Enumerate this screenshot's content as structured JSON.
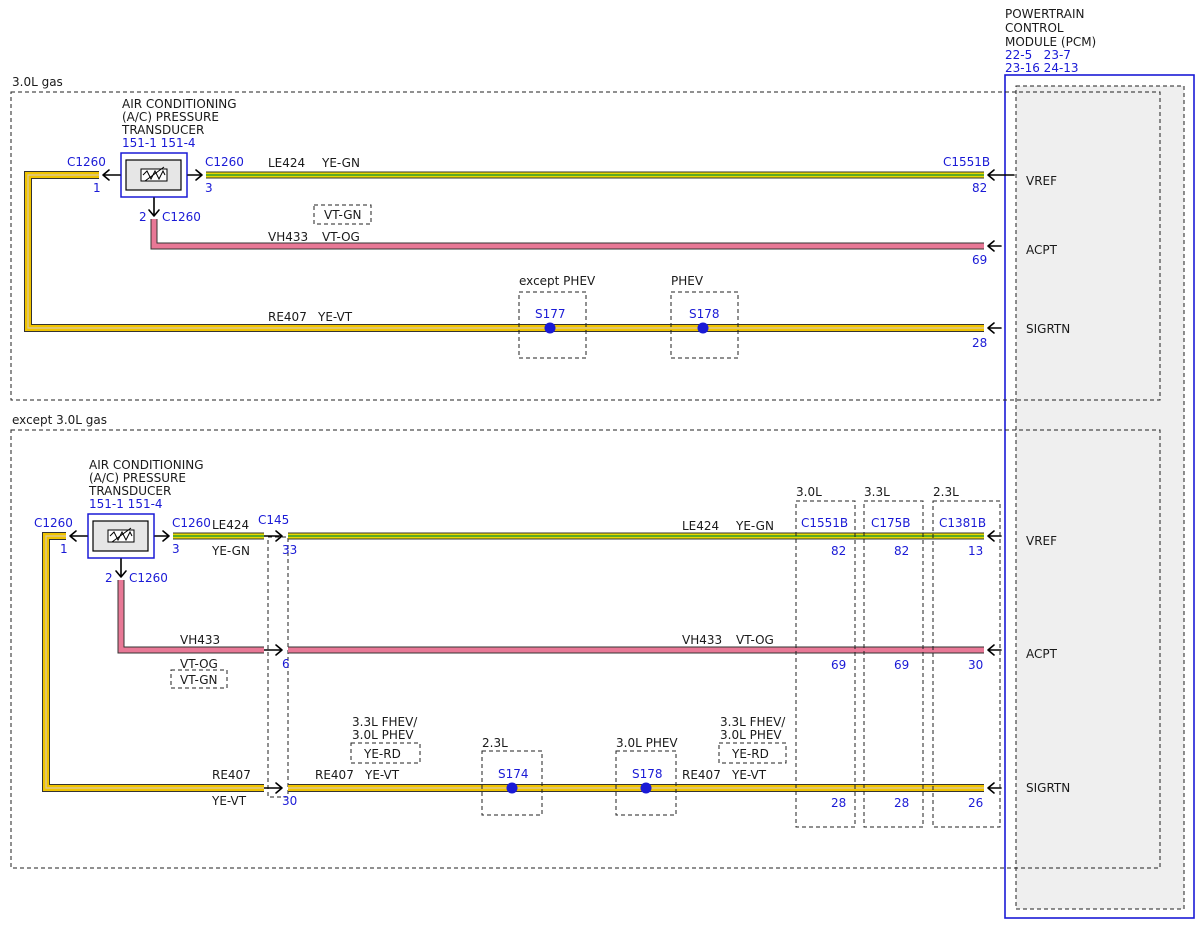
{
  "pcm": {
    "title_lines": [
      "POWERTRAIN",
      "CONTROL",
      "MODULE (PCM)"
    ],
    "refs_line1": "22-5   23-7",
    "refs_line2": "23-16 24-13",
    "pins": {
      "vref": "VREF",
      "acpt": "ACPT",
      "sigrtn": "SIGRTN"
    }
  },
  "top": {
    "section_label": "3.0L gas",
    "sensor": {
      "title_lines": [
        "AIR CONDITIONING",
        "(A/C) PRESSURE",
        "TRANSDUCER"
      ],
      "refs": "151-1 151-4",
      "conn_left": "C1260",
      "pin_left": "1",
      "conn_right": "C1260",
      "pin_right": "3",
      "pin_bottom": "2",
      "conn_bottom": "C1260"
    },
    "vref_wire": {
      "circuit": "LE424",
      "color": "YE-GN",
      "connector": "C1551B",
      "pin": "82"
    },
    "alt_color_box": "VT-GN",
    "acpt_wire": {
      "circuit": "VH433",
      "color": "VT-OG",
      "pin": "69"
    },
    "sig_wire": {
      "circuit": "RE407",
      "color": "YE-VT",
      "pin": "28"
    },
    "splices": [
      {
        "label": "except PHEV",
        "name": "S177"
      },
      {
        "label": "PHEV",
        "name": "S178"
      }
    ]
  },
  "bottom": {
    "section_label": "except 3.0L gas",
    "sensor": {
      "title_lines": [
        "AIR CONDITIONING",
        "(A/C) PRESSURE",
        "TRANSDUCER"
      ],
      "refs": "151-1 151-4",
      "conn_left": "C1260",
      "pin_left": "1",
      "conn_right": "C1260",
      "pin_right": "3",
      "pin_bottom": "2",
      "conn_bottom": "C1260"
    },
    "c145": {
      "name": "C145",
      "pin_vref": "33",
      "pin_acpt": "6",
      "pin_sig": "30",
      "left_vref_circuit": "LE424",
      "left_vref_color": "YE-GN",
      "left_acpt_circuit": "VH433",
      "left_acpt_color": "VT-OG",
      "alt_color_box": "VT-GN",
      "left_sig_circuit": "RE407",
      "left_sig_color": "YE-VT"
    },
    "vref_wire": {
      "circuit": "LE424",
      "color": "YE-GN"
    },
    "acpt_wire": {
      "circuit": "VH433",
      "color": "VT-OG"
    },
    "sig_wire": {
      "circuit": "RE407",
      "color": "YE-VT",
      "circuit2": "RE407",
      "color2": "YE-VT"
    },
    "option_box_1": {
      "line1": "3.3L FHEV/",
      "line2": "3.0L PHEV",
      "color": "YE-RD"
    },
    "option_box_2": {
      "line1": "3.3L FHEV/",
      "line2": "3.0L PHEV",
      "color": "YE-RD"
    },
    "splices": [
      {
        "label": "2.3L",
        "name": "S174"
      },
      {
        "label": "3.0L PHEV",
        "name": "S178"
      }
    ],
    "variants": [
      {
        "engine": "3.0L",
        "connector": "C1551B",
        "vref": "82",
        "acpt": "69",
        "sig": "28"
      },
      {
        "engine": "3.3L",
        "connector": "C175B",
        "vref": "82",
        "acpt": "69",
        "sig": "28"
      },
      {
        "engine": "2.3L",
        "connector": "C1381B",
        "vref": "13",
        "acpt": "30",
        "sig": "26"
      }
    ]
  },
  "colors": {
    "ye_gn_base": "#e8d800",
    "ye_gn_stripe": "#2f9a2f",
    "vt_og": "#e87896",
    "ye_vt_base": "#f0c400",
    "ye_vt_stripe": "#d9c8a8",
    "connector_blue": "#1a1ad6",
    "pcm_fill": "#efefef"
  }
}
